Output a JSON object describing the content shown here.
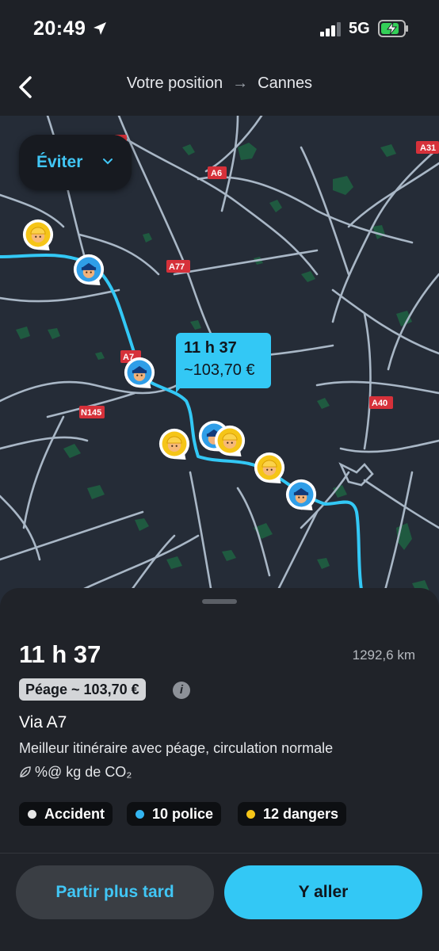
{
  "status_bar": {
    "time": "20:49",
    "network": "5G"
  },
  "header": {
    "origin": "Votre position",
    "destination": "Cannes"
  },
  "map": {
    "avoid_label": "Éviter",
    "road_labels": [
      "A31",
      "A6",
      "A77",
      "A7",
      "N145",
      "A40"
    ],
    "eta_bubble": {
      "time": "11 h 37",
      "price": "~103,70 €"
    },
    "route_color": "#33c8f5",
    "alerts": [
      "hazard",
      "police",
      "police",
      "hazard",
      "police",
      "hazard",
      "hazard",
      "police"
    ]
  },
  "sheet": {
    "time": "11 h 37",
    "distance": "1292,6 km",
    "toll": "Péage ~ 103,70 €",
    "info_icon": "i",
    "via": "Via A7",
    "description": "Meilleur itinéraire avec péage, circulation normale",
    "co2": "%@ kg de CO₂",
    "chips": [
      {
        "label": "Accident",
        "color": "#e6e6e6"
      },
      {
        "label": "10 police",
        "color": "#33b5f0"
      },
      {
        "label": "12 dangers",
        "color": "#f5c518"
      }
    ]
  },
  "actions": {
    "later": "Partir plus tard",
    "go": "Y aller"
  }
}
